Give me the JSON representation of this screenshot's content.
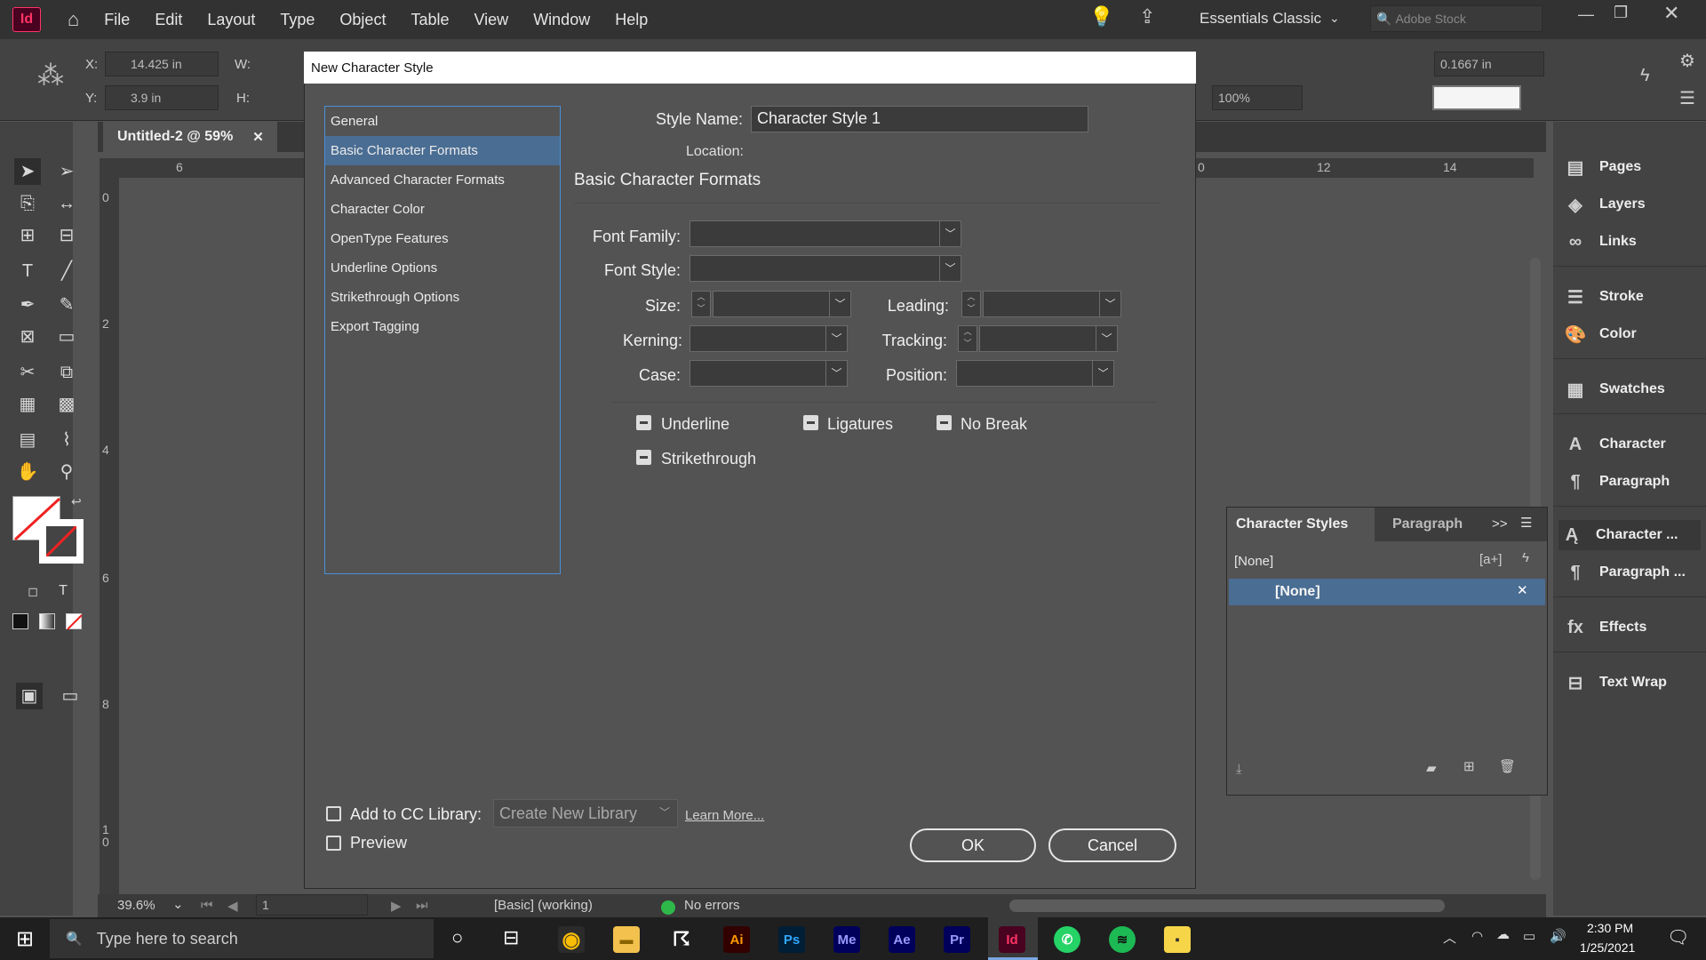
{
  "menubar": {
    "logo": "Id",
    "items": [
      "File",
      "Edit",
      "Layout",
      "Type",
      "Object",
      "Table",
      "View",
      "Window",
      "Help"
    ],
    "workspace": "Essentials Classic",
    "search_placeholder": "Adobe Stock"
  },
  "control": {
    "x_label": "X:",
    "x_value": "14.425 in",
    "y_label": "Y:",
    "y_value": "3.9 in",
    "w_label": "W:",
    "h_label": "H:",
    "zoom_value": "100%",
    "stroke_value": "0.1667 in"
  },
  "document": {
    "tab_title": "Untitled-2 @ 59%",
    "h_ruler": [
      "6",
      "0",
      "12",
      "14"
    ],
    "v_ruler": [
      "0",
      "2",
      "4",
      "6",
      "8",
      "1\n0"
    ]
  },
  "dialog": {
    "title": "New Character Style",
    "categories": [
      "General",
      "Basic Character Formats",
      "Advanced Character Formats",
      "Character Color",
      "OpenType Features",
      "Underline Options",
      "Strikethrough Options",
      "Export Tagging"
    ],
    "selected_category": "Basic Character Formats",
    "style_name_label": "Style Name:",
    "style_name_value": "Character Style 1",
    "location_label": "Location:",
    "section_heading": "Basic Character Formats",
    "font_family_label": "Font Family:",
    "font_style_label": "Font Style:",
    "size_label": "Size:",
    "leading_label": "Leading:",
    "kerning_label": "Kerning:",
    "tracking_label": "Tracking:",
    "case_label": "Case:",
    "position_label": "Position:",
    "underline_label": "Underline",
    "ligatures_label": "Ligatures",
    "nobreak_label": "No Break",
    "strikethrough_label": "Strikethrough",
    "add_cc_label": "Add to CC Library:",
    "library_value": "Create New Library",
    "learn_more": "Learn More...",
    "preview_label": "Preview",
    "ok_label": "OK",
    "cancel_label": "Cancel"
  },
  "right_panel": {
    "items": [
      "Pages",
      "Layers",
      "Links",
      "Stroke",
      "Color",
      "Swatches",
      "Character",
      "Paragraph",
      "Character ...",
      "Paragraph ...",
      "Effects",
      "Text Wrap"
    ]
  },
  "char_styles_panel": {
    "tab_active": "Character Styles",
    "tab_other": "Paragraph",
    "current": "[None]",
    "row": "[None]",
    "toggle": ">>"
  },
  "status": {
    "zoom": "39.6%",
    "page": "1",
    "preflight_profile": "[Basic] (working)",
    "errors": "No errors"
  },
  "taskbar": {
    "search_placeholder": "Type here to search",
    "time": "2:30 PM",
    "date": "1/25/2021",
    "apps": [
      "Ai",
      "Ps",
      "Me",
      "Ae",
      "Pr",
      "Id"
    ]
  },
  "colors": {
    "indesign": "#ff3366",
    "selection": "#4a6d93",
    "focus": "#4a90d9"
  }
}
